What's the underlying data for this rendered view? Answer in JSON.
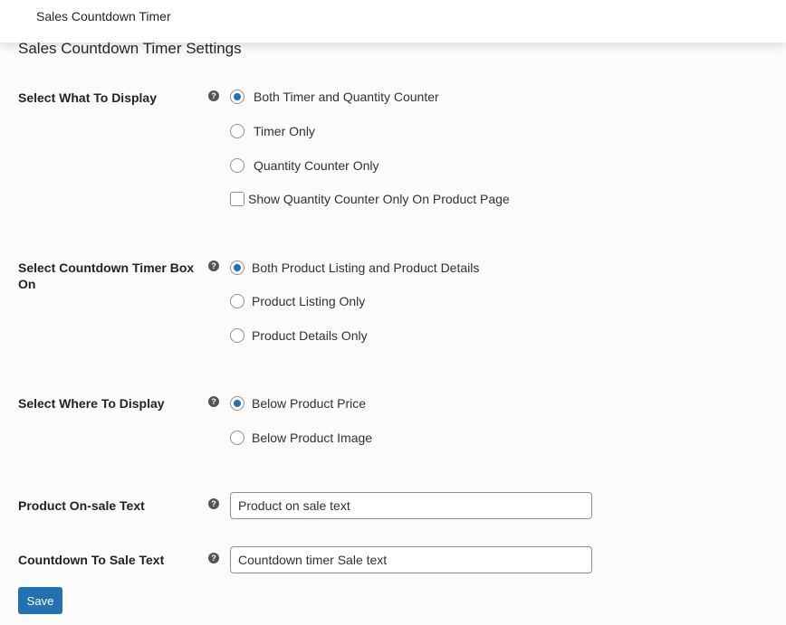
{
  "header": {
    "title": "Sales Countdown Timer"
  },
  "page_title": "Sales Countdown Timer Settings",
  "display": {
    "label": "Select What To Display",
    "options": [
      "Both Timer and Quantity Counter",
      "Timer Only",
      "Quantity Counter Only"
    ],
    "selected": 0,
    "checkbox": "Show Quantity Counter Only On Product Page",
    "checkbox_checked": false
  },
  "box_on": {
    "label": "Select Countdown Timer Box On",
    "options": [
      "Both Product Listing and Product Details",
      "Product Listing Only",
      "Product Details Only"
    ],
    "selected": 0
  },
  "where": {
    "label": "Select Where To Display",
    "options": [
      "Below Product Price",
      "Below Product Image"
    ],
    "selected": 0
  },
  "onsale": {
    "label": "Product On-sale Text",
    "value": "Product on sale text"
  },
  "countdown": {
    "label": "Countdown To Sale Text",
    "value": "Countdown timer Sale text"
  },
  "help_glyph": "?",
  "save_label": "Save"
}
